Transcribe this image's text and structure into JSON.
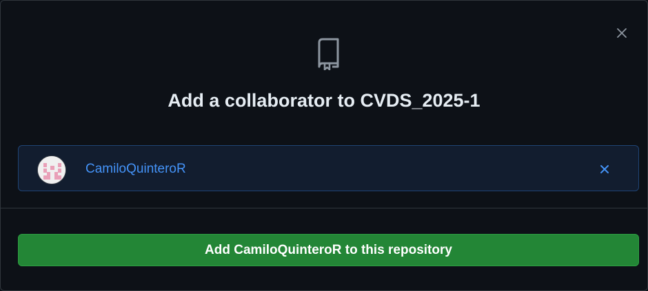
{
  "dialog": {
    "title_prefix": "Add a collaborator to ",
    "repository_name": "CVDS_2025-1",
    "close_icon": "x-icon",
    "repo_icon": "repo-icon"
  },
  "selected_user": {
    "username": "CamiloQuinteroR",
    "avatar_icon": "identicon-avatar",
    "remove_icon": "x-icon"
  },
  "actions": {
    "add_button_label": "Add CamiloQuinteroR to this repository"
  },
  "colors": {
    "background": "#0d1117",
    "text_primary": "#e6edf3",
    "link_blue": "#4493f8",
    "selected_bg": "#121d2f",
    "selected_border": "#1f4475",
    "button_green": "#238636",
    "icon_gray": "#8d96a0",
    "avatar_pink": "#e9a0b8"
  }
}
